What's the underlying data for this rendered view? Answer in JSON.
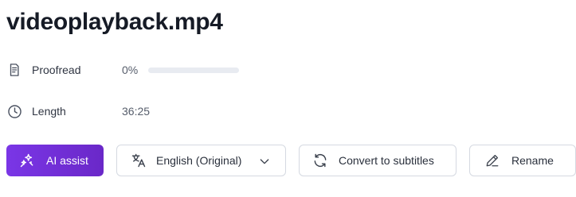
{
  "file": {
    "title": "videoplayback.mp4"
  },
  "details": {
    "proofread": {
      "label": "Proofread",
      "value": "0%",
      "progress_fraction": 0,
      "icon": "document-icon"
    },
    "length": {
      "label": "Length",
      "value": "36:25",
      "icon": "clock-icon"
    }
  },
  "actions": {
    "ai_assist": {
      "label": "AI assist",
      "icon": "sparkles-icon"
    },
    "language": {
      "label": "English (Original)",
      "icon": "translate-icon"
    },
    "convert": {
      "label": "Convert to subtitles",
      "icon": "refresh-icon"
    },
    "rename": {
      "label": "Rename",
      "icon": "pencil-icon"
    }
  },
  "colors": {
    "accent": "#7a36e6",
    "progress_track": "#e8ebf1"
  }
}
